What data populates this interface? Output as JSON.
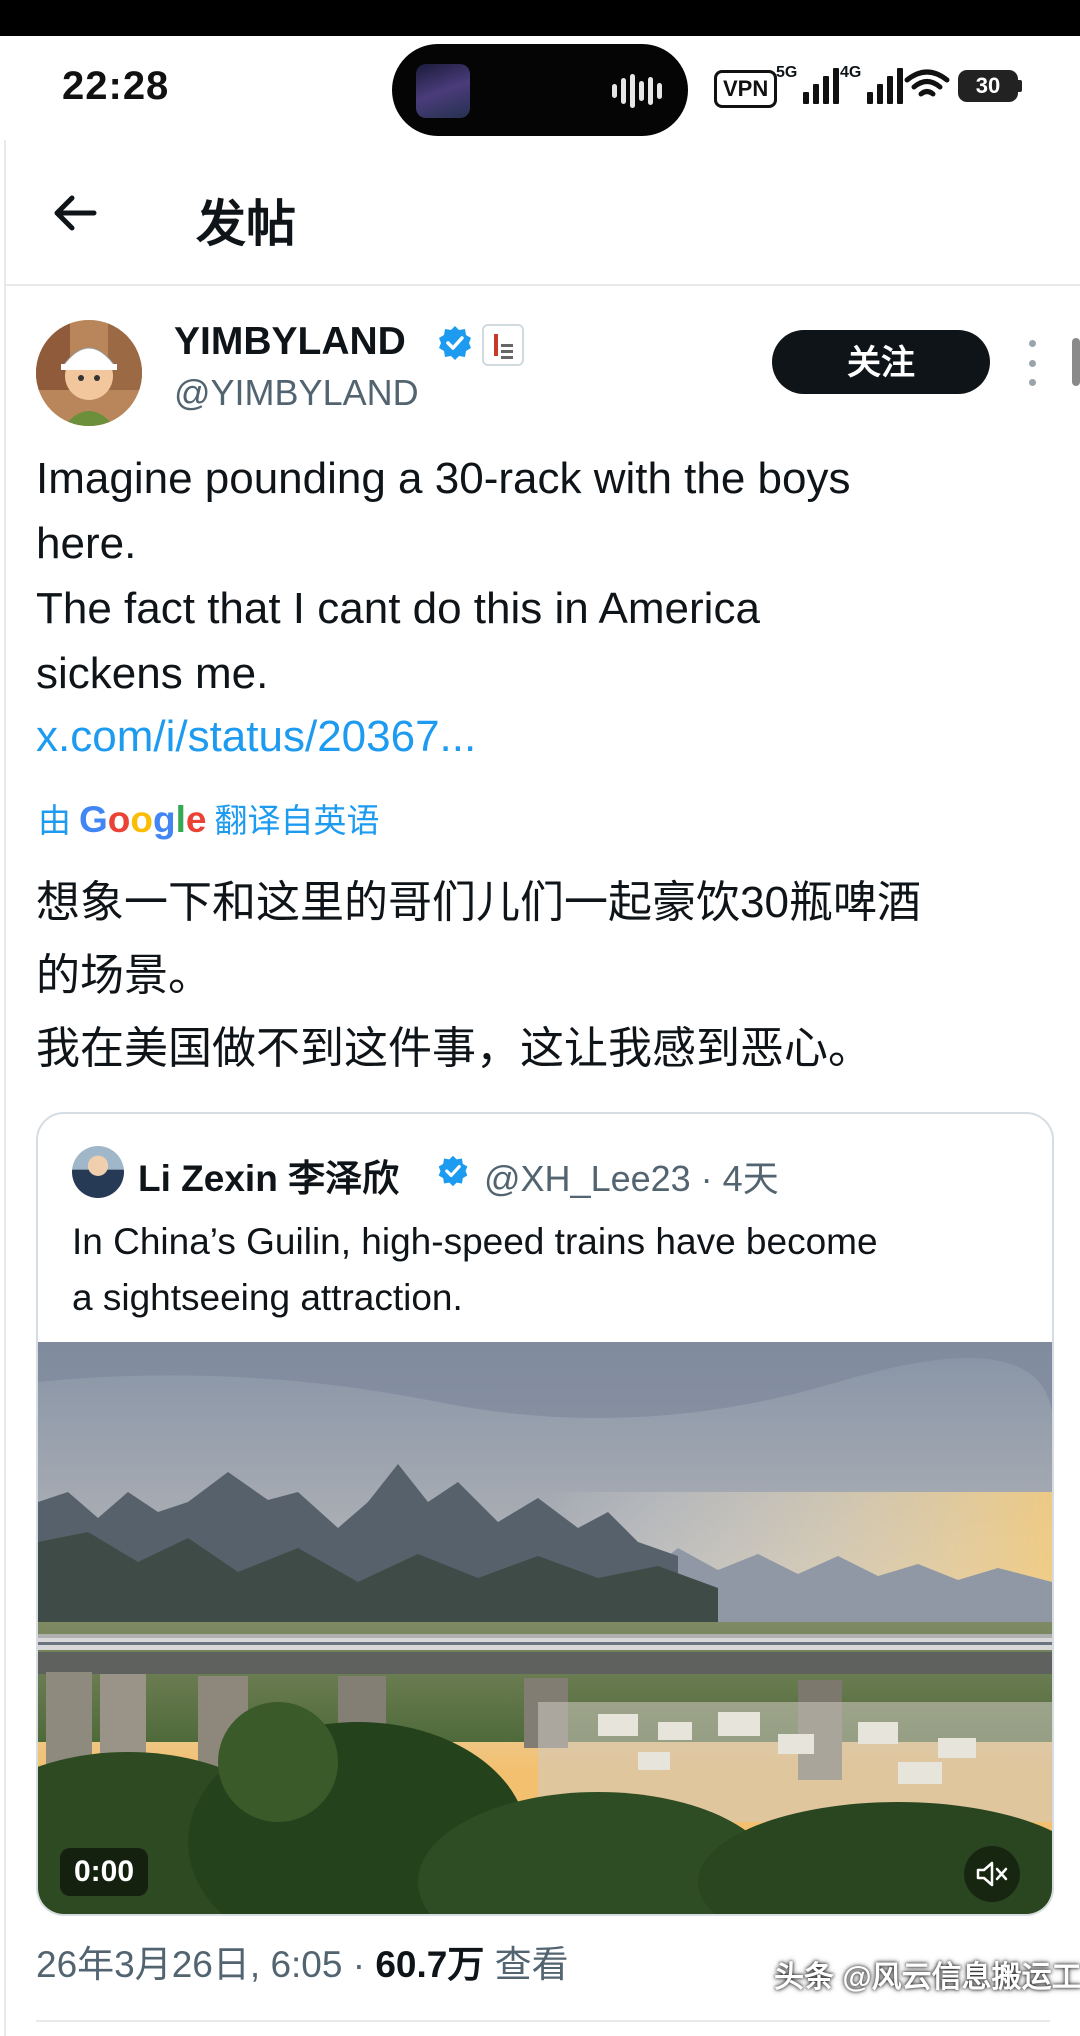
{
  "status_bar": {
    "time": "22:28",
    "vpn": "VPN",
    "network_1": "5G",
    "network_2": "4G",
    "battery": "30"
  },
  "header": {
    "title": "发帖"
  },
  "tweet": {
    "author_name": "YIMBYLAND",
    "author_handle": "@YIMBYLAND",
    "follow_label": "关注",
    "text_lines": [
      "Imagine pounding a 30-rack with the boys",
      "here.",
      "The fact that I cant do this in America",
      "sickens me."
    ],
    "link": "x.com/i/status/20367...",
    "translate_prefix": "由",
    "translate_brand": "Google",
    "translate_suffix": "翻译自英语",
    "translated_lines": [
      "想象一下和这里的哥们儿们一起豪饮30瓶啤酒",
      "的场景。",
      "我在美国做不到这件事，这让我感到恶心。"
    ],
    "date": "26年3月26日, 6:05 · ",
    "views_count": "60.7万",
    "views_label": " 查看"
  },
  "quote": {
    "name": "Li Zexin 李泽欣",
    "handle_time": "@XH_Lee23 · 4天",
    "text_lines": [
      "In China’s Guilin, high-speed trains have become",
      "a sightseeing attraction."
    ],
    "video_duration": "0:00"
  },
  "watermark": "头条 @风云信息搬运工",
  "colors": {
    "link_blue": "#1d9bf0",
    "verified_blue": "#1d9bf0",
    "text_primary": "#0f1419",
    "text_secondary": "#536471"
  },
  "icons": {
    "back": "arrow-left-icon",
    "verified": "verified-badge-icon",
    "more": "more-vertical-icon",
    "mute": "volume-mute-icon"
  }
}
